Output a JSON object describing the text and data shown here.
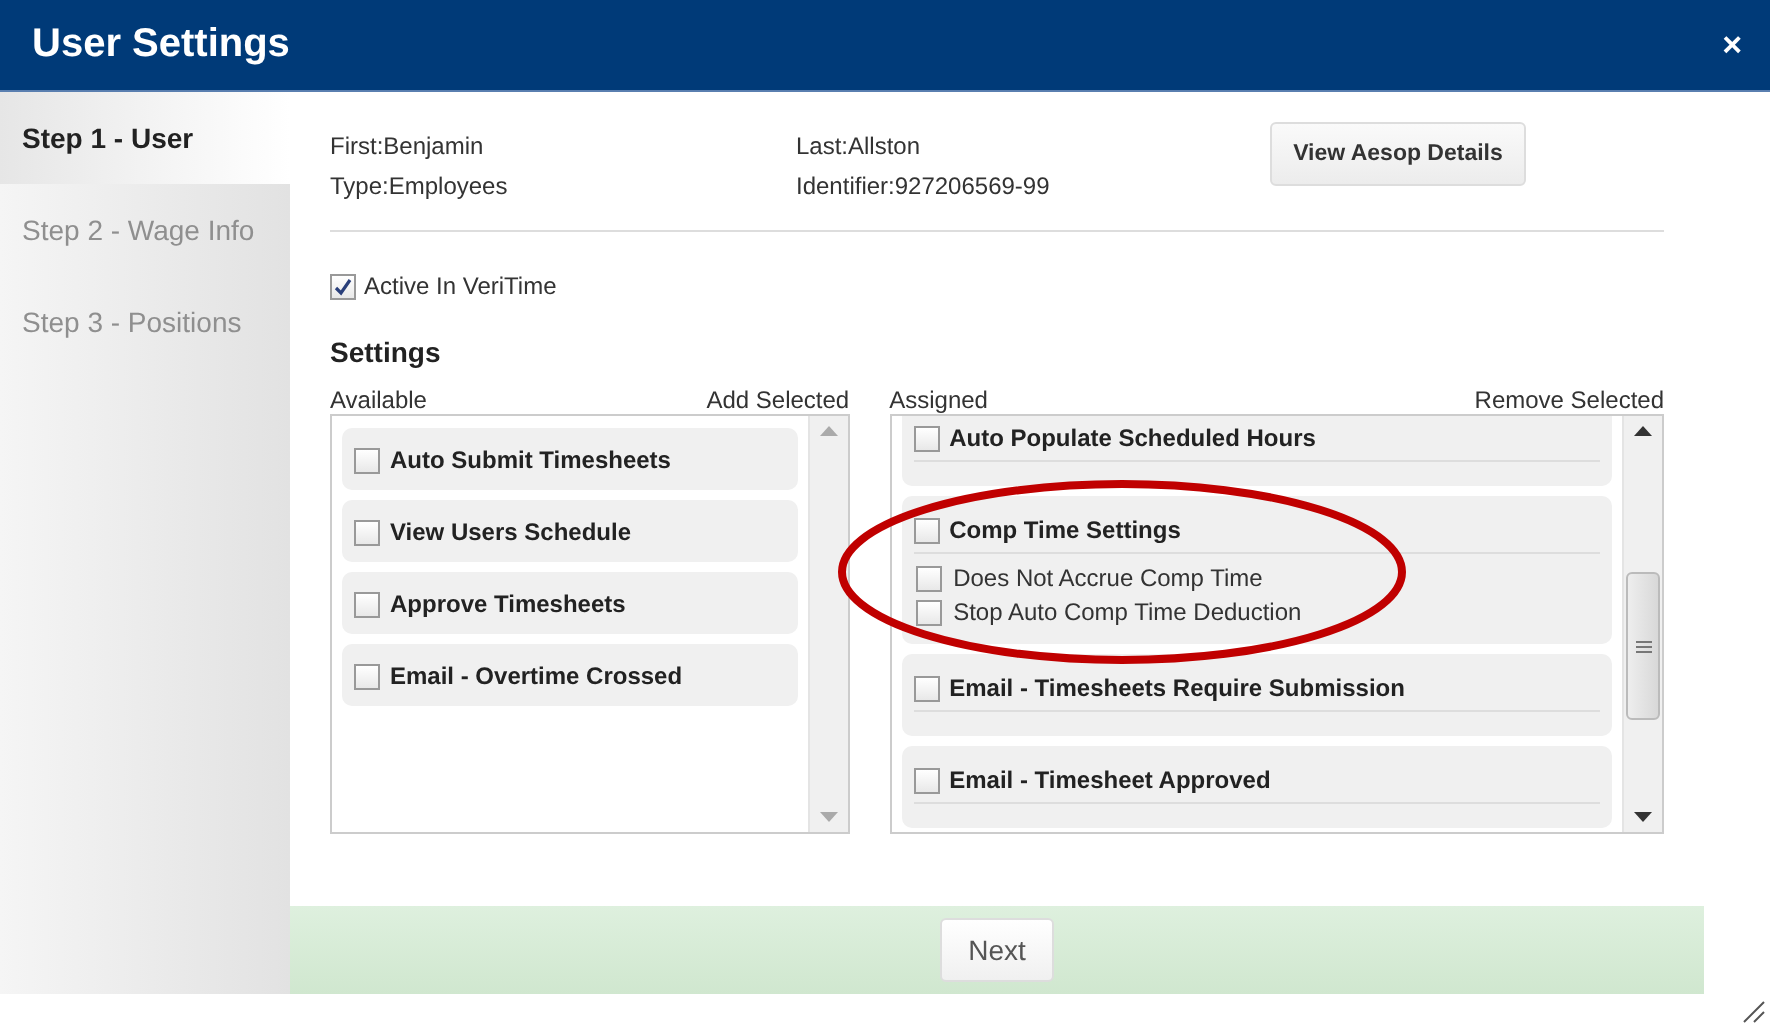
{
  "window": {
    "title": "User Settings",
    "close": "×"
  },
  "steps": [
    {
      "label": "Step 1 - User",
      "selected": true
    },
    {
      "label": "Step 2 - Wage Info",
      "selected": false
    },
    {
      "label": "Step 3 - Positions",
      "selected": false
    }
  ],
  "user": {
    "first": "First:Benjamin",
    "last": "Last:Allston",
    "type": "Type:Employees",
    "identifier": "Identifier:927206569-99",
    "details_button": "View Aesop Details"
  },
  "active": {
    "label": "Active In VeriTime",
    "checked": true
  },
  "settings": {
    "heading": "Settings",
    "available": {
      "label": "Available",
      "action": "Add Selected",
      "items": [
        {
          "label": "Auto Submit Timesheets",
          "checked": false
        },
        {
          "label": "View Users Schedule",
          "checked": false
        },
        {
          "label": "Approve Timesheets",
          "checked": false
        },
        {
          "label": "Email - Overtime Crossed",
          "checked": false
        }
      ]
    },
    "assigned": {
      "label": "Assigned",
      "action": "Remove Selected",
      "items": [
        {
          "label": "Auto Populate Scheduled Hours",
          "checked": false
        },
        {
          "label": "Comp Time Settings",
          "checked": false,
          "children": [
            {
              "label": "Does Not Accrue Comp Time",
              "checked": false
            },
            {
              "label": "Stop Auto Comp Time Deduction",
              "checked": false
            }
          ]
        },
        {
          "label": "Email - Timesheets Require Submission",
          "checked": false
        },
        {
          "label": "Email - Timesheet Approved",
          "checked": false
        }
      ]
    }
  },
  "footer": {
    "next_button": "Next"
  }
}
